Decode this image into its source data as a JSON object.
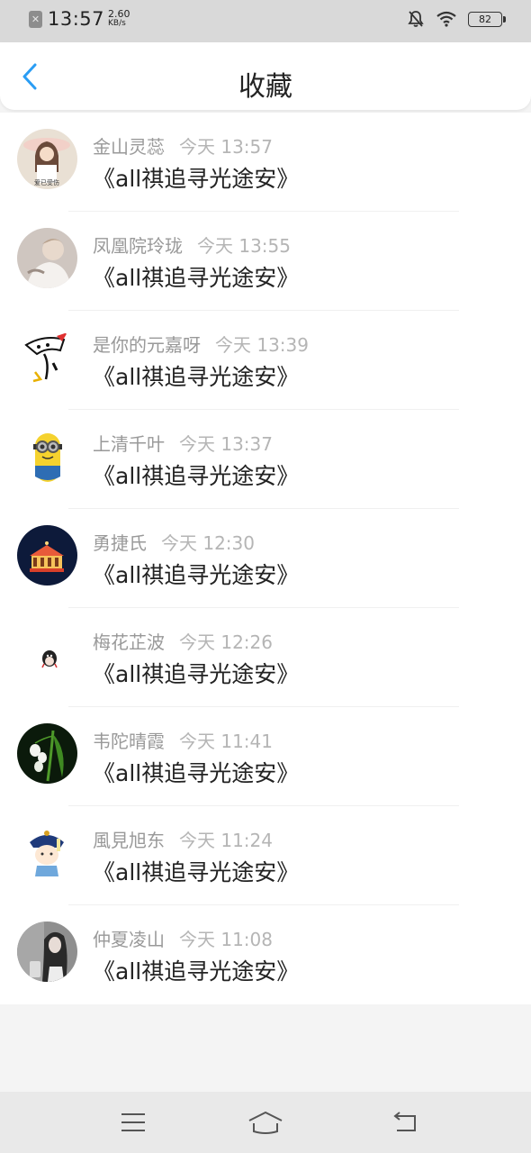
{
  "status_bar": {
    "time": "13:57",
    "speed_value": "2.60",
    "speed_unit": "KB/s",
    "battery": "82"
  },
  "header": {
    "title": "收藏"
  },
  "favorites": [
    {
      "name": "金山灵蕊",
      "time": "今天 13:57",
      "content": "《all祺追寻光途安》"
    },
    {
      "name": "凤凰院玲珑",
      "time": "今天 13:55",
      "content": "《all祺追寻光途安》"
    },
    {
      "name": "是你的元嘉呀",
      "time": "今天 13:39",
      "content": "《all祺追寻光途安》"
    },
    {
      "name": "上清千叶",
      "time": "今天 13:37",
      "content": "《all祺追寻光途安》"
    },
    {
      "name": "勇捷氏",
      "time": "今天 12:30",
      "content": "《all祺追寻光途安》"
    },
    {
      "name": "梅花芷波",
      "time": "今天 12:26",
      "content": "《all祺追寻光途安》"
    },
    {
      "name": "韦陀晴霞",
      "time": "今天 11:41",
      "content": "《all祺追寻光途安》"
    },
    {
      "name": "風見旭东",
      "time": "今天 11:24",
      "content": "《all祺追寻光途安》"
    },
    {
      "name": "仲夏凌山",
      "time": "今天 11:08",
      "content": "《all祺追寻光途安》"
    }
  ],
  "avatar_text": "爱已受伤",
  "colors": {
    "accent": "#2a9df4",
    "name_gray": "#999999",
    "time_gray": "#b5b5b5"
  },
  "icons": [
    "notification-app-icon",
    "silent-bell-icon",
    "wifi-icon",
    "battery-icon",
    "back-arrow-icon",
    "menu-icon",
    "home-icon",
    "back-icon"
  ]
}
